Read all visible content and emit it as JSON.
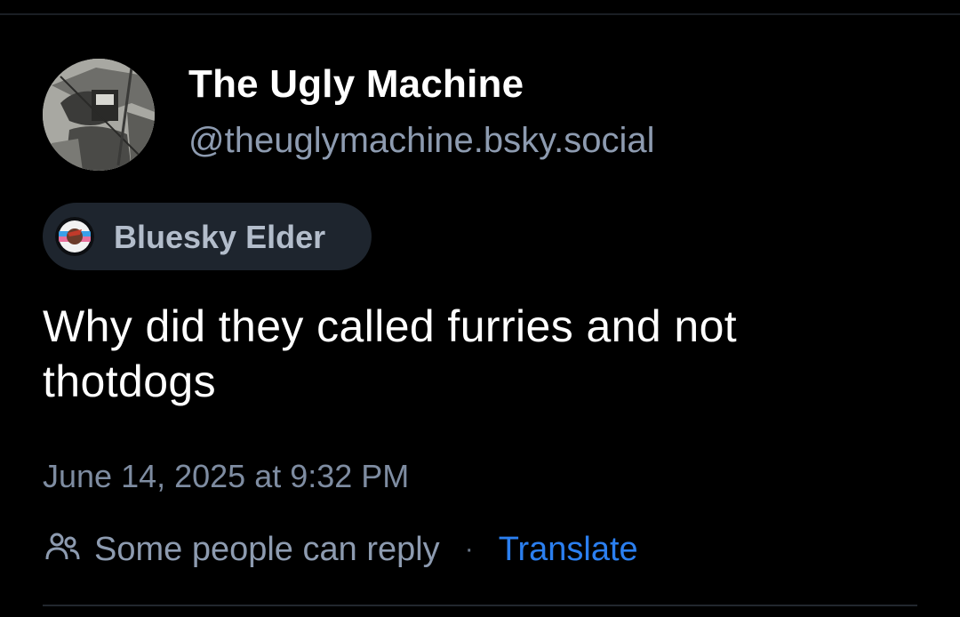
{
  "author": {
    "display_name": "The Ugly Machine",
    "handle": "@theuglymachine.bsky.social",
    "avatar_icon": "avatar-image"
  },
  "badge": {
    "label": "Bluesky Elder",
    "icon": "badge-emblem-icon"
  },
  "post": {
    "text": "Why did they called furries and not thotdogs",
    "timestamp": "June 14, 2025 at 9:32 PM"
  },
  "footer": {
    "reply_icon": "people-icon",
    "reply_label": "Some people can reply",
    "separator": "·",
    "translate_label": "Translate"
  },
  "colors": {
    "background": "#000000",
    "muted_text": "#8d9bb0",
    "link": "#2b7ff0",
    "badge_bg": "#1e252e"
  }
}
